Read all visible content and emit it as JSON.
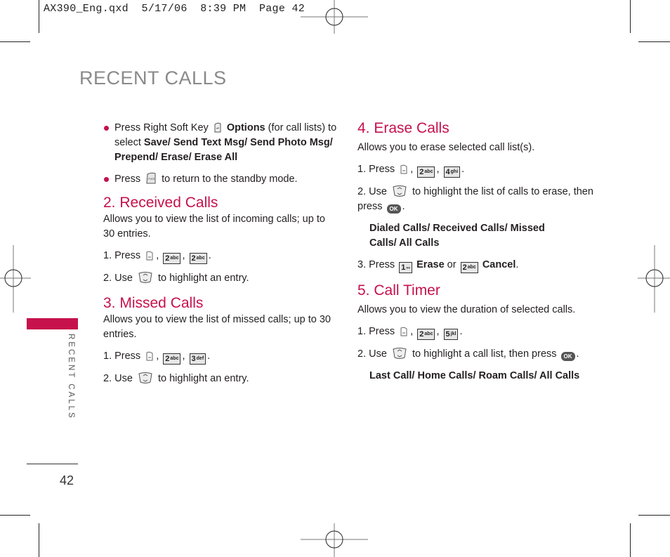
{
  "slug": "AX390_Eng.qxd  5/17/06  8:39 PM  Page 42",
  "page_title": "RECENT CALLS",
  "side_tab_label": "RECENT CALLS",
  "page_number": "42",
  "colors": {
    "accent": "#c6114c",
    "title_gray": "#8a8a8a"
  },
  "icons": {
    "soft_key": "right-soft-key-icon",
    "end_key": "end-key-icon",
    "menu_key": "left-soft-key-icon",
    "nav_key": "navigation-key-icon",
    "ok_key": "ok-key-icon"
  },
  "intro": {
    "bullet1": {
      "pre": "Press Right Soft Key",
      "options": "Options",
      "mid": " (for call lists) to select ",
      "items": "Save/ Send Text Msg/ Send Photo Msg/ Prepend/ Erase/ Erase All"
    },
    "bullet2": {
      "pre": "Press",
      "post": "to return to the standby mode."
    }
  },
  "keys": {
    "k1": {
      "num": "1",
      "letters": "ₒₒ"
    },
    "k2": {
      "num": "2",
      "letters": "abc"
    },
    "k3": {
      "num": "3",
      "letters": "def"
    },
    "k4": {
      "num": "4",
      "letters": "ghi"
    },
    "k5": {
      "num": "5",
      "letters": "jkl"
    },
    "ok": "OK"
  },
  "sections": {
    "received": {
      "title": "2. Received Calls",
      "desc": "Allows you to view the list of incoming calls; up to 30 entries.",
      "step1": "1. Press",
      "step2_pre": "2. Use",
      "step2_post": "to highlight an entry."
    },
    "missed": {
      "title": "3. Missed Calls",
      "desc": "Allows you to view the list of missed calls; up to 30 entries.",
      "step1": "1. Press",
      "step2_pre": "2. Use",
      "step2_post": "to highlight an entry."
    },
    "erase": {
      "title": "4. Erase Calls",
      "desc": "Allows you to erase selected call list(s).",
      "step1": "1. Press",
      "step2_pre": "2. Use",
      "step2_post": "to highlight the list of calls to erase, then press",
      "options": "Dialed Calls/ Received Calls/ Missed Calls/ All Calls",
      "step3_pre": "3. Press",
      "erase_label": "Erase",
      "or": "or",
      "cancel_label": "Cancel"
    },
    "timer": {
      "title": "5. Call Timer",
      "desc": "Allows you to view the duration of selected calls.",
      "step1": "1. Press",
      "step2_pre": "2. Use",
      "step2_post": "to highlight a call list, then press",
      "options": "Last Call/ Home Calls/ Roam Calls/ All Calls"
    }
  }
}
